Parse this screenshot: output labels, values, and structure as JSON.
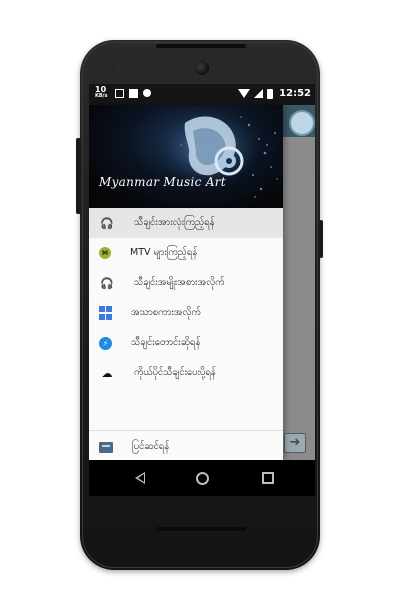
{
  "status_bar": {
    "net_speed": "10",
    "net_unit": "KB/s",
    "time": "12:52"
  },
  "drawer": {
    "header_title": "Myanmar Music Art",
    "items": [
      {
        "label": "သီချင်းအားလုံးကြည့်ရန်",
        "icon": "headphones-icon",
        "active": true
      },
      {
        "label": "MTV များကြည့်ရန်",
        "icon": "mtv-icon",
        "active": false
      },
      {
        "label": "သီချင်းအမျိုးအစားအလိုက်",
        "icon": "music-headphones-icon",
        "active": false
      },
      {
        "label": "အသာစကားအလိုက်",
        "icon": "grid-icon",
        "active": false
      },
      {
        "label": "သီချင်းတောင်းဆိုရန်",
        "icon": "messenger-icon",
        "active": false
      },
      {
        "label": "ကိုယ်ပိုင်သီချင်းပေးပို့ရန်",
        "icon": "upload-cloud-icon",
        "active": false
      }
    ],
    "footer_item": {
      "label": "ပြင်ဆင်ရန်",
      "icon": "exit-icon"
    }
  },
  "nav_bar": {
    "back": "back-icon",
    "home": "home-icon",
    "recents": "recents-icon"
  },
  "colors": {
    "app_bar": "#3b5866",
    "drawer_active": "#e6e6e6"
  }
}
